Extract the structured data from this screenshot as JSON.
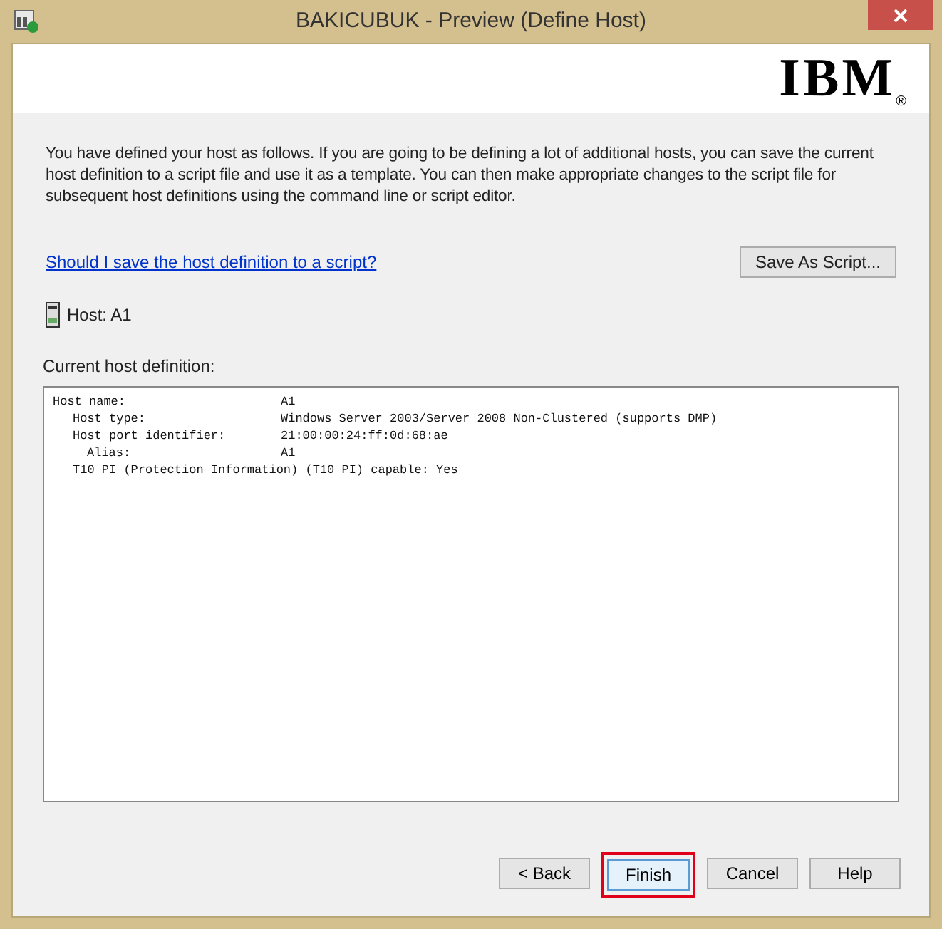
{
  "window": {
    "title": "BAKICUBUK - Preview (Define Host)"
  },
  "header": {
    "logo": "IBM",
    "logo_mark": "®"
  },
  "intro": "You have defined your host as follows.  If you are going to be defining a lot of additional hosts, you can save the current host definition to a script file and use it as a template. You can then make appropriate changes to the script file for subsequent host definitions using the command line or script editor.",
  "help_link": "Should I save the host definition to a script?",
  "save_button": "Save As Script...",
  "host_label": "Host: A1",
  "definition": {
    "label": "Current host definition:",
    "lines": [
      {
        "label": "Host name:",
        "value": "A1",
        "children": [
          {
            "label": "Host type:",
            "value": "Windows Server 2003/Server 2008 Non-Clustered (supports DMP)"
          },
          {
            "label": "Host port identifier:",
            "value": "21:00:00:24:ff:0d:68:ae",
            "children": [
              {
                "label": "Alias:",
                "value": "A1"
              }
            ]
          },
          {
            "label": "T10 PI (Protection Information) (T10 PI) capable: Yes"
          }
        ]
      }
    ]
  },
  "buttons": [
    {
      "label": "< Back",
      "focused": false,
      "highlighted": false
    },
    {
      "label": "Finish",
      "focused": true,
      "highlighted": true
    },
    {
      "label": "Cancel",
      "focused": false,
      "highlighted": false
    },
    {
      "label": "Help",
      "focused": false,
      "highlighted": false
    }
  ]
}
